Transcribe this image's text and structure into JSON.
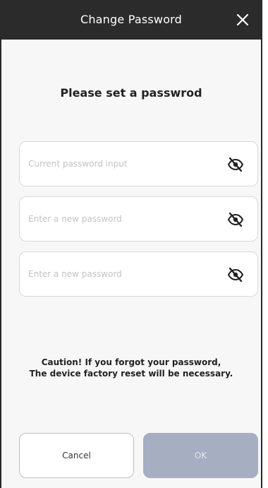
{
  "header": {
    "title": "Change Password",
    "close_icon": "close-icon"
  },
  "subtitle": "Please set a passwrod",
  "fields": [
    {
      "placeholder": "Current password input",
      "value": "",
      "icon": "eye-slash-icon"
    },
    {
      "placeholder": "Enter a new password",
      "value": "",
      "icon": "eye-slash-icon"
    },
    {
      "placeholder": "Enter a new password",
      "value": "",
      "icon": "eye-slash-icon"
    }
  ],
  "caution": {
    "line1": "Caution! If you forgot your password,",
    "line2": "The device factory reset will be necessary."
  },
  "buttons": {
    "cancel": "Cancel",
    "ok": "OK"
  },
  "colors": {
    "header_bg": "#2b2b2b",
    "ok_disabled_bg": "#a6aec2"
  }
}
